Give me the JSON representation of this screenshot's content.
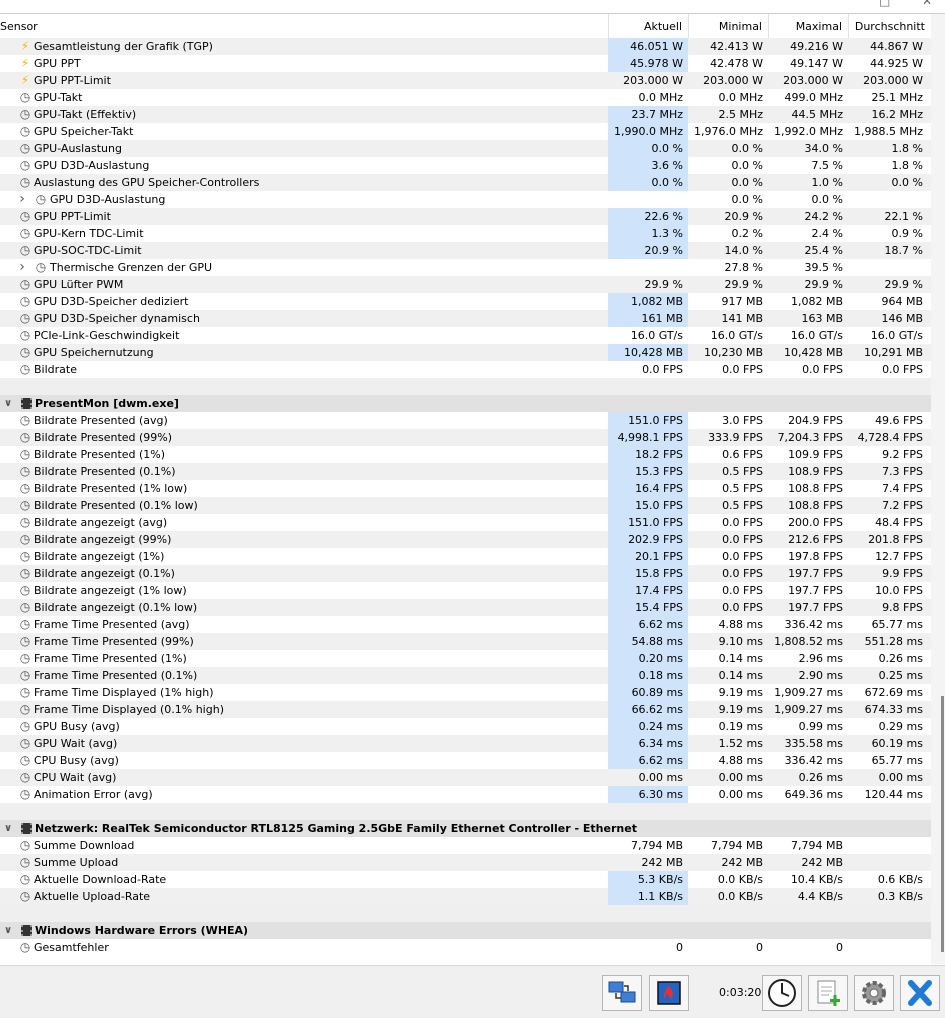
{
  "columns": {
    "sensor": "Sensor",
    "current": "Aktuell",
    "min": "Minimal",
    "max": "Maximal",
    "avg": "Durchschnitt"
  },
  "rows": [
    {
      "icon": "bolt",
      "indent": 1,
      "label": "Gesamtleistung der Grafik (TGP)",
      "v": [
        "46.051 W",
        "42.413 W",
        "49.216 W",
        "44.867 W"
      ],
      "hl": true,
      "bg": "alt"
    },
    {
      "icon": "bolt",
      "indent": 1,
      "label": "GPU PPT",
      "v": [
        "45.978 W",
        "42.478 W",
        "49.147 W",
        "44.925 W"
      ],
      "hl": true
    },
    {
      "icon": "bolt",
      "indent": 1,
      "label": "GPU PPT-Limit",
      "v": [
        "203.000 W",
        "203.000 W",
        "203.000 W",
        "203.000 W"
      ],
      "bg": "alt"
    },
    {
      "icon": "clock",
      "indent": 1,
      "label": "GPU-Takt",
      "v": [
        "0.0 MHz",
        "0.0 MHz",
        "499.0 MHz",
        "25.1 MHz"
      ]
    },
    {
      "icon": "clock",
      "indent": 1,
      "label": "GPU-Takt (Effektiv)",
      "v": [
        "23.7 MHz",
        "2.5 MHz",
        "44.5 MHz",
        "16.2 MHz"
      ],
      "hl": true,
      "bg": "alt"
    },
    {
      "icon": "clock",
      "indent": 1,
      "label": "GPU Speicher-Takt",
      "v": [
        "1,990.0 MHz",
        "1,976.0 MHz",
        "1,992.0 MHz",
        "1,988.5 MHz"
      ],
      "hl": true
    },
    {
      "icon": "clock",
      "indent": 1,
      "label": "GPU-Auslastung",
      "v": [
        "0.0 %",
        "0.0 %",
        "34.0 %",
        "1.8 %"
      ],
      "hl": true,
      "bg": "alt"
    },
    {
      "icon": "clock",
      "indent": 1,
      "label": "GPU D3D-Auslastung",
      "v": [
        "3.6 %",
        "0.0 %",
        "7.5 %",
        "1.8 %"
      ],
      "hl": true
    },
    {
      "icon": "clock",
      "indent": 1,
      "label": "Auslastung des GPU Speicher-Controllers",
      "v": [
        "0.0 %",
        "0.0 %",
        "1.0 %",
        "0.0 %"
      ],
      "hl": true,
      "bg": "alt"
    },
    {
      "icon": "clock",
      "indent": 2,
      "expand": true,
      "label": "GPU D3D-Auslastung",
      "v": [
        "",
        "0.0 %",
        "0.0 %",
        ""
      ]
    },
    {
      "icon": "clock",
      "indent": 1,
      "label": "GPU PPT-Limit",
      "v": [
        "22.6 %",
        "20.9 %",
        "24.2 %",
        "22.1 %"
      ],
      "hl": true,
      "bg": "alt"
    },
    {
      "icon": "clock",
      "indent": 1,
      "label": "GPU-Kern TDC-Limit",
      "v": [
        "1.3 %",
        "0.2 %",
        "2.4 %",
        "0.9 %"
      ],
      "hl": true
    },
    {
      "icon": "clock",
      "indent": 1,
      "label": "GPU-SOC-TDC-Limit",
      "v": [
        "20.9 %",
        "14.0 %",
        "25.4 %",
        "18.7 %"
      ],
      "hl": true,
      "bg": "alt"
    },
    {
      "icon": "clock",
      "indent": 2,
      "expand": true,
      "label": "Thermische Grenzen der GPU",
      "v": [
        "",
        "27.8 %",
        "39.5 %",
        ""
      ]
    },
    {
      "icon": "clock",
      "indent": 1,
      "label": "GPU Lüfter PWM",
      "v": [
        "29.9 %",
        "29.9 %",
        "29.9 %",
        "29.9 %"
      ],
      "bg": "alt"
    },
    {
      "icon": "clock",
      "indent": 1,
      "label": "GPU D3D-Speicher dediziert",
      "v": [
        "1,082 MB",
        "917 MB",
        "1,082 MB",
        "964 MB"
      ],
      "hl": true
    },
    {
      "icon": "clock",
      "indent": 1,
      "label": "GPU D3D-Speicher dynamisch",
      "v": [
        "161 MB",
        "141 MB",
        "163 MB",
        "146 MB"
      ],
      "hl": true,
      "bg": "alt"
    },
    {
      "icon": "clock",
      "indent": 1,
      "label": "PCIe-Link-Geschwindigkeit",
      "v": [
        "16.0 GT/s",
        "16.0 GT/s",
        "16.0 GT/s",
        "16.0 GT/s"
      ]
    },
    {
      "icon": "clock",
      "indent": 1,
      "label": "GPU Speichernutzung",
      "v": [
        "10,428 MB",
        "10,230 MB",
        "10,428 MB",
        "10,291 MB"
      ],
      "hl": true,
      "bg": "alt"
    },
    {
      "icon": "clock",
      "indent": 1,
      "label": "Bildrate",
      "v": [
        "0.0 FPS",
        "0.0 FPS",
        "0.0 FPS",
        "0.0 FPS"
      ]
    },
    {
      "type": "blank"
    },
    {
      "type": "header",
      "label": "PresentMon [dwm.exe]"
    },
    {
      "icon": "clock",
      "indent": 1,
      "label": "Bildrate Presented (avg)",
      "v": [
        "151.0 FPS",
        "3.0 FPS",
        "204.9 FPS",
        "49.6 FPS"
      ],
      "hl": true
    },
    {
      "icon": "clock",
      "indent": 1,
      "label": "Bildrate Presented (99%)",
      "v": [
        "4,998.1 FPS",
        "333.9 FPS",
        "7,204.3 FPS",
        "4,728.4 FPS"
      ],
      "hl": true,
      "bg": "alt"
    },
    {
      "icon": "clock",
      "indent": 1,
      "label": "Bildrate Presented (1%)",
      "v": [
        "18.2 FPS",
        "0.6 FPS",
        "109.9 FPS",
        "9.2 FPS"
      ],
      "hl": true
    },
    {
      "icon": "clock",
      "indent": 1,
      "label": "Bildrate Presented (0.1%)",
      "v": [
        "15.3 FPS",
        "0.5 FPS",
        "108.9 FPS",
        "7.3 FPS"
      ],
      "hl": true,
      "bg": "alt"
    },
    {
      "icon": "clock",
      "indent": 1,
      "label": "Bildrate Presented (1% low)",
      "v": [
        "16.4 FPS",
        "0.5 FPS",
        "108.8 FPS",
        "7.4 FPS"
      ],
      "hl": true
    },
    {
      "icon": "clock",
      "indent": 1,
      "label": "Bildrate Presented (0.1% low)",
      "v": [
        "15.0 FPS",
        "0.5 FPS",
        "108.8 FPS",
        "7.2 FPS"
      ],
      "hl": true,
      "bg": "alt"
    },
    {
      "icon": "clock",
      "indent": 1,
      "label": "Bildrate angezeigt (avg)",
      "v": [
        "151.0 FPS",
        "0.0 FPS",
        "200.0 FPS",
        "48.4 FPS"
      ],
      "hl": true
    },
    {
      "icon": "clock",
      "indent": 1,
      "label": "Bildrate angezeigt (99%)",
      "v": [
        "202.9 FPS",
        "0.0 FPS",
        "212.6 FPS",
        "201.8 FPS"
      ],
      "hl": true,
      "bg": "alt"
    },
    {
      "icon": "clock",
      "indent": 1,
      "label": "Bildrate angezeigt (1%)",
      "v": [
        "20.1 FPS",
        "0.0 FPS",
        "197.8 FPS",
        "12.7 FPS"
      ],
      "hl": true
    },
    {
      "icon": "clock",
      "indent": 1,
      "label": "Bildrate angezeigt (0.1%)",
      "v": [
        "15.8 FPS",
        "0.0 FPS",
        "197.7 FPS",
        "9.9 FPS"
      ],
      "hl": true,
      "bg": "alt"
    },
    {
      "icon": "clock",
      "indent": 1,
      "label": "Bildrate angezeigt (1% low)",
      "v": [
        "17.4 FPS",
        "0.0 FPS",
        "197.7 FPS",
        "10.0 FPS"
      ],
      "hl": true
    },
    {
      "icon": "clock",
      "indent": 1,
      "label": "Bildrate angezeigt (0.1% low)",
      "v": [
        "15.4 FPS",
        "0.0 FPS",
        "197.7 FPS",
        "9.8 FPS"
      ],
      "hl": true,
      "bg": "alt"
    },
    {
      "icon": "clock",
      "indent": 1,
      "label": "Frame Time Presented (avg)",
      "v": [
        "6.62 ms",
        "4.88 ms",
        "336.42 ms",
        "65.77 ms"
      ],
      "hl": true
    },
    {
      "icon": "clock",
      "indent": 1,
      "label": "Frame Time Presented (99%)",
      "v": [
        "54.88 ms",
        "9.10 ms",
        "1,808.52 ms",
        "551.28 ms"
      ],
      "hl": true,
      "bg": "alt"
    },
    {
      "icon": "clock",
      "indent": 1,
      "label": "Frame Time Presented (1%)",
      "v": [
        "0.20 ms",
        "0.14 ms",
        "2.96 ms",
        "0.26 ms"
      ],
      "hl": true
    },
    {
      "icon": "clock",
      "indent": 1,
      "label": "Frame Time Presented (0.1%)",
      "v": [
        "0.18 ms",
        "0.14 ms",
        "2.90 ms",
        "0.25 ms"
      ],
      "hl": true,
      "bg": "alt"
    },
    {
      "icon": "clock",
      "indent": 1,
      "label": "Frame Time Displayed (1% high)",
      "v": [
        "60.89 ms",
        "9.19 ms",
        "1,909.27 ms",
        "672.69 ms"
      ],
      "hl": true
    },
    {
      "icon": "clock",
      "indent": 1,
      "label": "Frame Time Displayed (0.1% high)",
      "v": [
        "66.62 ms",
        "9.19 ms",
        "1,909.27 ms",
        "674.33 ms"
      ],
      "hl": true,
      "bg": "alt"
    },
    {
      "icon": "clock",
      "indent": 1,
      "label": "GPU Busy (avg)",
      "v": [
        "0.24 ms",
        "0.19 ms",
        "0.99 ms",
        "0.29 ms"
      ],
      "hl": true
    },
    {
      "icon": "clock",
      "indent": 1,
      "label": "GPU Wait (avg)",
      "v": [
        "6.34 ms",
        "1.52 ms",
        "335.58 ms",
        "60.19 ms"
      ],
      "hl": true,
      "bg": "alt"
    },
    {
      "icon": "clock",
      "indent": 1,
      "label": "CPU Busy (avg)",
      "v": [
        "6.62 ms",
        "4.88 ms",
        "336.42 ms",
        "65.77 ms"
      ],
      "hl": true
    },
    {
      "icon": "clock",
      "indent": 1,
      "label": "CPU Wait (avg)",
      "v": [
        "0.00 ms",
        "0.00 ms",
        "0.26 ms",
        "0.00 ms"
      ],
      "bg": "alt"
    },
    {
      "icon": "clock",
      "indent": 1,
      "label": "Animation Error (avg)",
      "v": [
        "6.30 ms",
        "0.00 ms",
        "649.36 ms",
        "120.44 ms"
      ],
      "hl": true
    },
    {
      "type": "blank"
    },
    {
      "type": "header",
      "label": "Netzwerk: RealTek Semiconductor RTL8125 Gaming 2.5GbE Family Ethernet Controller - Ethernet"
    },
    {
      "icon": "clock",
      "indent": 1,
      "label": "Summe Download",
      "v": [
        "7,794 MB",
        "7,794 MB",
        "7,794 MB",
        ""
      ]
    },
    {
      "icon": "clock",
      "indent": 1,
      "label": "Summe Upload",
      "v": [
        "242 MB",
        "242 MB",
        "242 MB",
        ""
      ],
      "bg": "alt"
    },
    {
      "icon": "clock",
      "indent": 1,
      "label": "Aktuelle Download-Rate",
      "v": [
        "5.3 KB/s",
        "0.0 KB/s",
        "10.4 KB/s",
        "0.6 KB/s"
      ],
      "hl": true
    },
    {
      "icon": "clock",
      "indent": 1,
      "label": "Aktuelle Upload-Rate",
      "v": [
        "1.1 KB/s",
        "0.0 KB/s",
        "4.4 KB/s",
        "0.3 KB/s"
      ],
      "hl": true,
      "bg": "alt"
    },
    {
      "type": "blank"
    },
    {
      "type": "header",
      "label": "Windows Hardware Errors (WHEA)"
    },
    {
      "icon": "clock",
      "indent": 1,
      "label": "Gesamtfehler",
      "v": [
        "0",
        "0",
        "0",
        ""
      ]
    }
  ],
  "footer": {
    "elapsed": "0:03:20",
    "buttons": [
      {
        "name": "network-icon-button",
        "icon": "network-icon"
      },
      {
        "name": "sensor-fire-button",
        "icon": "fire-chip-icon"
      },
      {
        "name": "timer-clock-button",
        "icon": "clock-icon"
      },
      {
        "name": "add-report-button",
        "icon": "add-document-icon"
      },
      {
        "name": "settings-button",
        "icon": "gear-icon"
      },
      {
        "name": "close-button",
        "icon": "close-icon"
      }
    ]
  },
  "colors": {
    "highlight": "#cfe4fb",
    "alt_row": "#f0f0f0",
    "group_header": "#e1e1e1",
    "bolt": "#f3b800"
  }
}
